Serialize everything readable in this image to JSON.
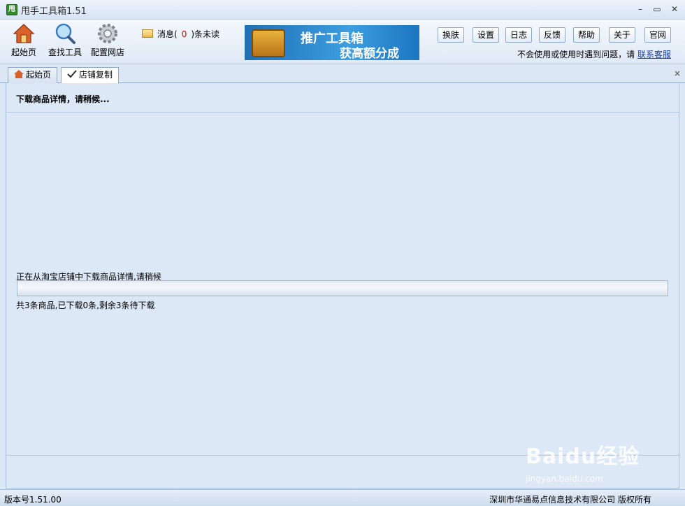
{
  "window": {
    "logo_text": "甩",
    "title": "甩手工具箱1.51",
    "minimize": "–",
    "maximize": "▭",
    "close": "✕"
  },
  "toolbar": {
    "home": "起始页",
    "find": "查找工具",
    "config": "配置网店",
    "msg_prefix": "消息(",
    "msg_count": "0",
    "msg_suffix": ")条未读",
    "banner_line1": "推广工具箱",
    "banner_line2": "获高额分成",
    "buttons": [
      "换肤",
      "设置",
      "日志",
      "反馈",
      "帮助",
      "关于",
      "官网"
    ],
    "help_text": "不会使用或使用时遇到问题，请",
    "help_link": "联系客服"
  },
  "tabs": [
    {
      "label": "起始页",
      "icon": "home-icon",
      "active": false
    },
    {
      "label": "店铺复制",
      "icon": "check-pen-icon",
      "active": true
    }
  ],
  "tab_close": "×",
  "content": {
    "heading": "下载商品详情，请稍候...",
    "status": "正在从淘宝店铺中下载商品详情,请稍候",
    "progress": 0,
    "count_text": "共3条商品,已下载0条,剩余3条待下载"
  },
  "statusbar": {
    "version": "版本号1.51.00",
    "copyright": "深圳市华通易点信息技术有限公司  版权所有"
  },
  "watermark": {
    "line1": "Baidu经验",
    "line2": "jingyan.baidu.com"
  }
}
